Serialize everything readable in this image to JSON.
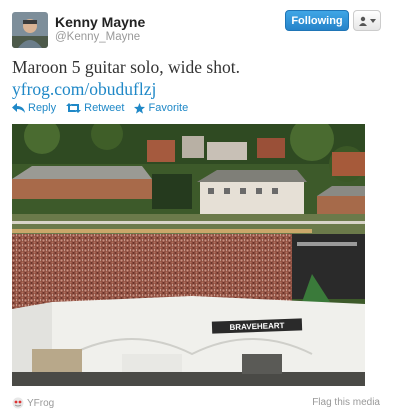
{
  "header": {
    "display_name": "Kenny Mayne",
    "username": "@Kenny_Mayne",
    "follow_label": "Following",
    "avatar_icon": "user-avatar-photo",
    "menu_icon": "user-dropdown-icon"
  },
  "tweet": {
    "text": "Maroon 5 guitar solo, wide shot.",
    "link": "yfrog.com/obuduflzj"
  },
  "actions": {
    "reply": "Reply",
    "retweet": "Retweet",
    "favorite": "Favorite"
  },
  "photo": {
    "banner_text": "BRAVEHEART",
    "description_icon": "concert-crowd-photo"
  },
  "footer": {
    "source": "YFrog",
    "flag": "Flag this media"
  },
  "colors": {
    "link": "#1f88c7",
    "follow_button": "#2683c9"
  }
}
